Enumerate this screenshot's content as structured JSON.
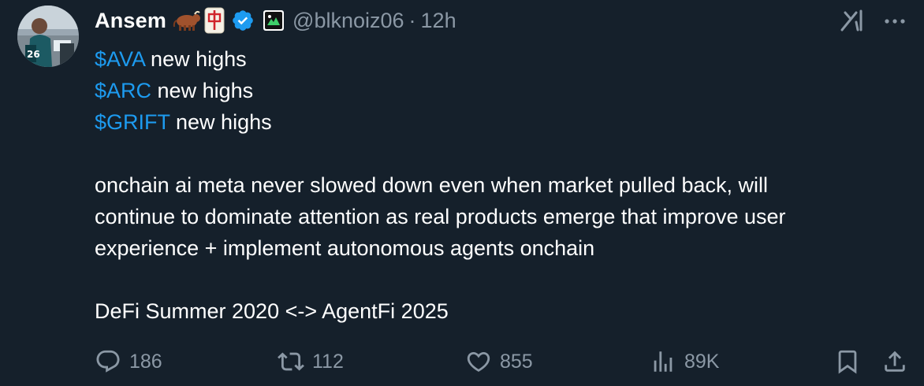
{
  "tweet": {
    "author_name": "Ansem",
    "handle": "@blknoiz06",
    "separator": "·",
    "time": "12h",
    "lines": [
      {
        "tag": "$AVA",
        "rest": " new highs"
      },
      {
        "tag": "$ARC",
        "rest": " new highs"
      },
      {
        "tag": "$GRIFT",
        "rest": " new highs"
      }
    ],
    "paragraph_lines": [
      "onchain ai meta never slowed down even when market pulled back, will",
      "continue to dominate attention as real products emerge that improve user",
      "experience + implement autonomous agents onchain"
    ],
    "closing_line": "DeFi Summer 2020 <-> AgentFi 2025"
  },
  "actions": {
    "replies": "186",
    "reposts": "112",
    "likes": "855",
    "views": "89K"
  },
  "colors": {
    "background": "#15202b",
    "cashtag": "#1d9bf0",
    "muted": "#8b98a5",
    "verified": "#1d9bf0"
  },
  "icons": [
    "ox-emoji-icon",
    "mahjong-red-dragon-icon",
    "verified-badge-icon",
    "affiliate-badge-icon",
    "grok-icon",
    "more-icon",
    "reply-icon",
    "repost-icon",
    "like-icon",
    "views-icon",
    "bookmark-icon",
    "share-icon"
  ]
}
